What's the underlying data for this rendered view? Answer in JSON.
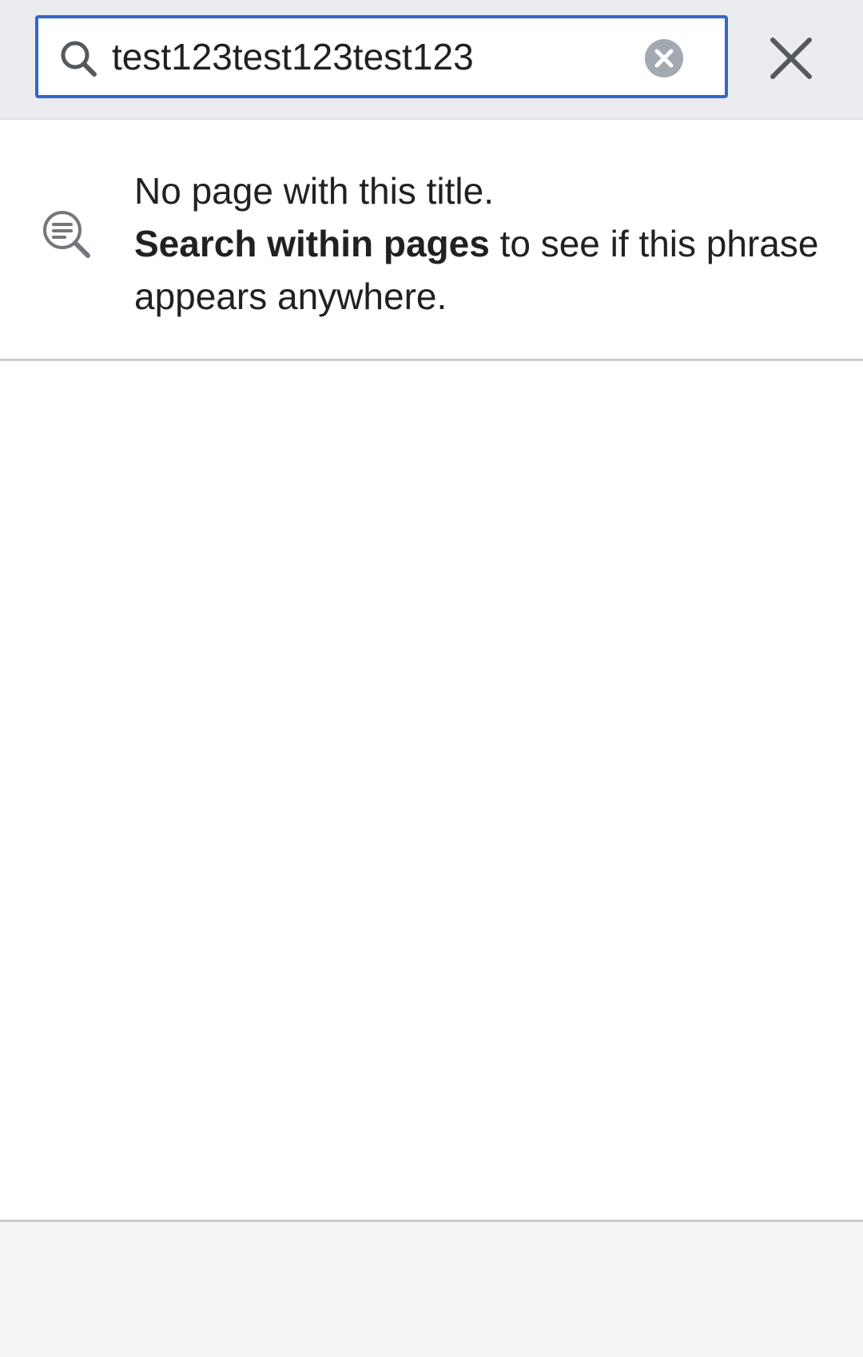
{
  "search": {
    "value": "test123test123test123",
    "icon": "search-icon",
    "clear_icon": "clear-circle-icon",
    "close_icon": "close-icon"
  },
  "notice": {
    "icon": "search-in-text-icon",
    "line1": "No page with this title.",
    "link_bold": "Search within pages",
    "rest": " to see if this phrase appears anywhere."
  },
  "colors": {
    "accent": "#3366cc",
    "header_bg": "#eaecf0",
    "text": "#202122",
    "icon_gray": "#72777d"
  }
}
